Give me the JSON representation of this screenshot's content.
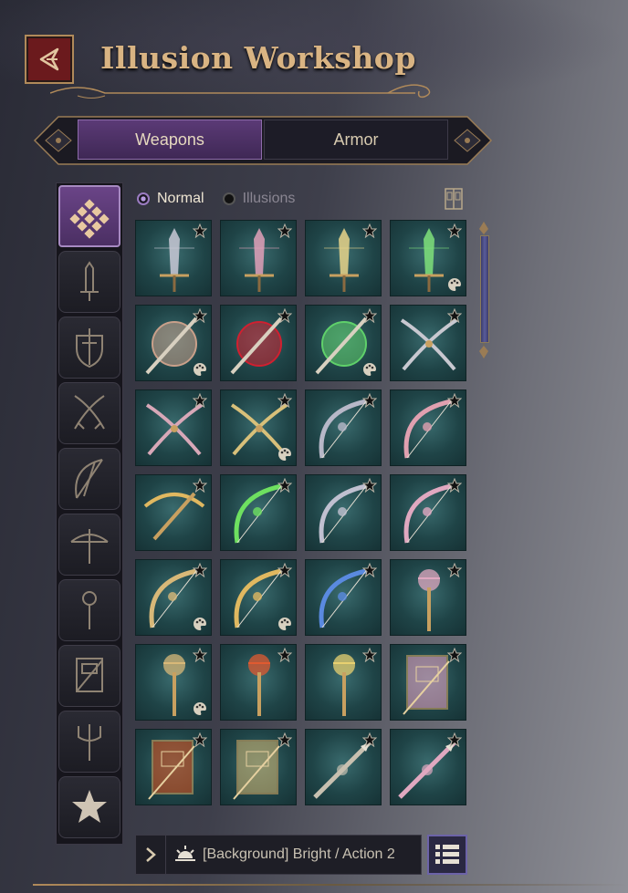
{
  "header": {
    "title": "Illusion Workshop",
    "logo_icon": "back-chevron-icon"
  },
  "tabs": [
    {
      "label": "Weapons",
      "active": true
    },
    {
      "label": "Armor",
      "active": false
    }
  ],
  "filter": {
    "options": [
      {
        "label": "Normal",
        "selected": true
      },
      {
        "label": "Illusions",
        "selected": false
      }
    ],
    "wardrobe_icon": "wardrobe-icon"
  },
  "categories": [
    {
      "name": "all-weapons-icon",
      "active": true
    },
    {
      "name": "greatsword-icon",
      "active": false
    },
    {
      "name": "sword-shield-icon",
      "active": false
    },
    {
      "name": "dual-blades-icon",
      "active": false
    },
    {
      "name": "bow-icon",
      "active": false
    },
    {
      "name": "crossbow-icon",
      "active": false
    },
    {
      "name": "staff-icon",
      "active": false
    },
    {
      "name": "tome-icon",
      "active": false
    },
    {
      "name": "trident-icon",
      "active": false
    },
    {
      "name": "favorites-star-icon",
      "active": false
    }
  ],
  "items": [
    {
      "kind": "greatsword",
      "palette": false,
      "hue": "#c9c9d6"
    },
    {
      "kind": "greatsword",
      "palette": false,
      "hue": "#e0a0b8"
    },
    {
      "kind": "greatsword",
      "palette": false,
      "hue": "#e8d38a"
    },
    {
      "kind": "greatsword",
      "palette": true,
      "hue": "#7fe07a"
    },
    {
      "kind": "shield",
      "palette": true,
      "hue": "#c9a08a"
    },
    {
      "kind": "shield",
      "palette": false,
      "hue": "#d02030"
    },
    {
      "kind": "shield",
      "palette": true,
      "hue": "#5fd06a"
    },
    {
      "kind": "dual",
      "palette": false,
      "hue": "#c8c8d0"
    },
    {
      "kind": "dual",
      "palette": false,
      "hue": "#d8a8b8"
    },
    {
      "kind": "dual",
      "palette": true,
      "hue": "#d8c07a"
    },
    {
      "kind": "bow",
      "palette": false,
      "hue": "#b8b8c8"
    },
    {
      "kind": "bow",
      "palette": false,
      "hue": "#e0a0b0"
    },
    {
      "kind": "crossbow",
      "palette": false,
      "hue": "#e0b860"
    },
    {
      "kind": "bow",
      "palette": false,
      "hue": "#6ee060"
    },
    {
      "kind": "bow",
      "palette": false,
      "hue": "#c0c0d0"
    },
    {
      "kind": "bow",
      "palette": false,
      "hue": "#e0a8c0"
    },
    {
      "kind": "bow",
      "palette": true,
      "hue": "#d8b878"
    },
    {
      "kind": "bow",
      "palette": true,
      "hue": "#e0b860"
    },
    {
      "kind": "bow",
      "palette": false,
      "hue": "#5a8ae0"
    },
    {
      "kind": "staff",
      "palette": false,
      "hue": "#e0a8c0"
    },
    {
      "kind": "staff",
      "palette": true,
      "hue": "#d8b878"
    },
    {
      "kind": "staff",
      "palette": false,
      "hue": "#e05a30"
    },
    {
      "kind": "staff",
      "palette": false,
      "hue": "#e8d070"
    },
    {
      "kind": "tome",
      "palette": false,
      "hue": "#e0a0c0"
    },
    {
      "kind": "tome",
      "palette": false,
      "hue": "#d05020"
    },
    {
      "kind": "tome",
      "palette": false,
      "hue": "#c8b070"
    },
    {
      "kind": "spear",
      "palette": false,
      "hue": "#c8c0b0"
    },
    {
      "kind": "spear",
      "palette": false,
      "hue": "#e0a8c0"
    }
  ],
  "bottom_bar": {
    "text": "[Background] Bright / Action 2",
    "expand_icon": "chevron-right-icon",
    "sun_icon": "brightness-icon",
    "list_icon": "list-icon"
  }
}
